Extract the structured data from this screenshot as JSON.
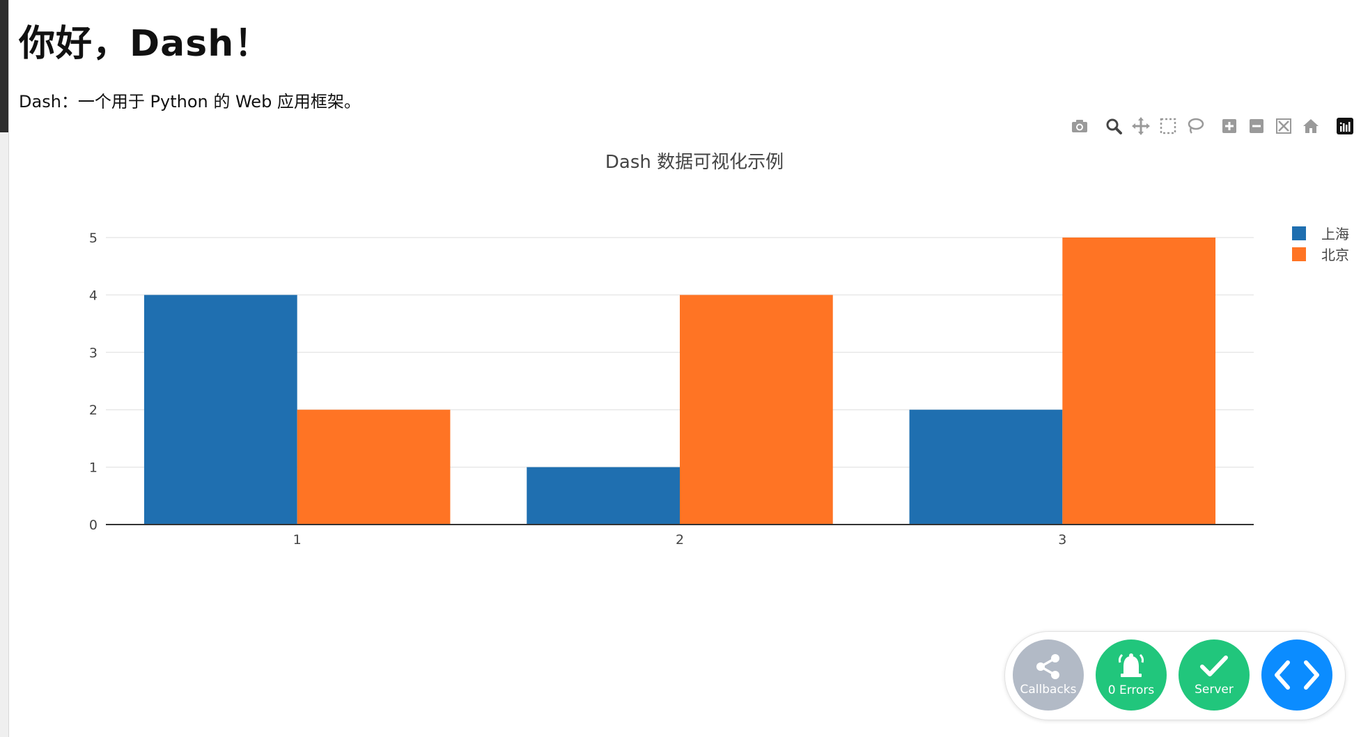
{
  "header": {
    "title": "你好，Dash！",
    "subtitle": "Dash：一个用于 Python 的 Web 应用框架。"
  },
  "modebar": {
    "icons": [
      "camera-icon",
      "zoom-icon",
      "pan-icon",
      "box-select-icon",
      "lasso-icon",
      "zoom-in-icon",
      "zoom-out-icon",
      "autoscale-icon",
      "reset-axes-icon",
      "plotly-logo-icon"
    ]
  },
  "chart_data": {
    "type": "bar",
    "title": "Dash 数据可视化示例",
    "categories": [
      "1",
      "2",
      "3"
    ],
    "series": [
      {
        "name": "上海",
        "values": [
          4,
          1,
          2
        ],
        "color": "#1f6fb0"
      },
      {
        "name": "北京",
        "values": [
          2,
          4,
          5
        ],
        "color": "#ff7424"
      }
    ],
    "xlabel": "",
    "ylabel": "",
    "ylim": [
      0,
      5
    ],
    "yticks": [
      0,
      1,
      2,
      3,
      4,
      5
    ],
    "grid": true,
    "legend_position": "top-right"
  },
  "devtools": {
    "callbacks_label": "Callbacks",
    "errors_label": "0 Errors",
    "server_label": "Server",
    "colors": {
      "callbacks": "#b2bac6",
      "errors": "#21c67c",
      "server": "#21c67c",
      "toggle": "#0b8cff"
    }
  }
}
